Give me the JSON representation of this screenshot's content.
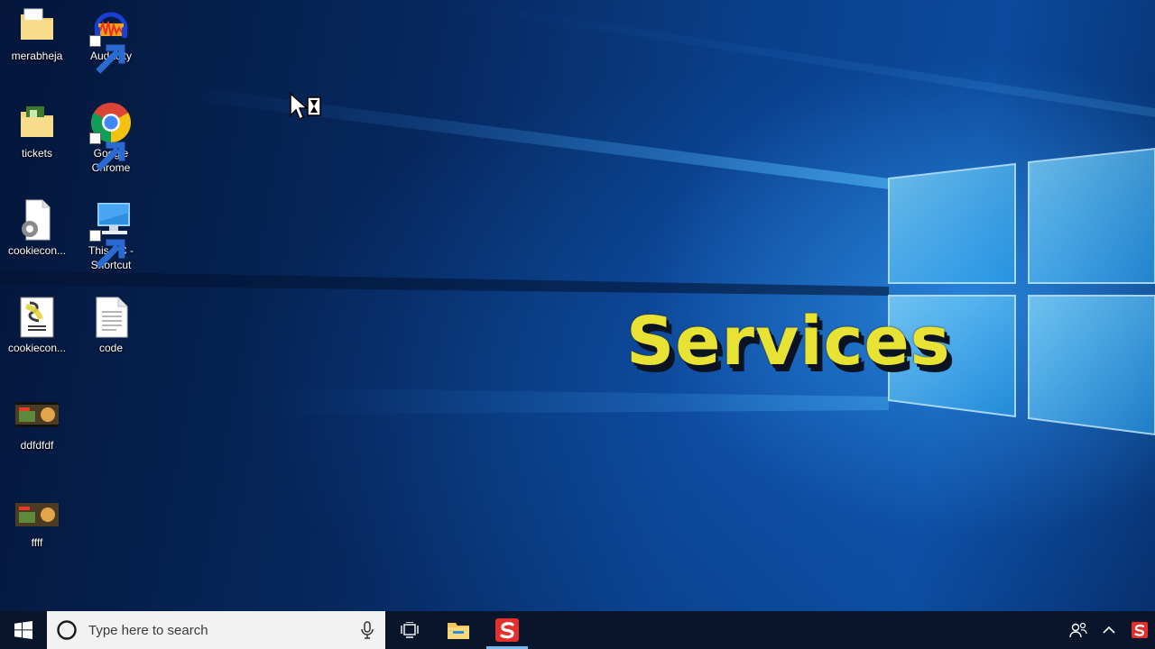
{
  "desktop": {
    "icons": [
      {
        "label": "merabheja",
        "icon": "folder-icon"
      },
      {
        "label": "Audacity",
        "icon": "audacity-icon"
      },
      {
        "label": "tickets",
        "icon": "folder-icon"
      },
      {
        "label": "Google Chrome",
        "icon": "chrome-icon"
      },
      {
        "label": "cookiecon...",
        "icon": "settings-file-icon"
      },
      {
        "label": "This PC - Shortcut",
        "icon": "computer-icon"
      },
      {
        "label": "cookiecon...",
        "icon": "script-file-icon"
      },
      {
        "label": "code",
        "icon": "text-file-icon"
      },
      {
        "label": "ddfdfdf",
        "icon": "image-thumbnail-icon"
      },
      {
        "label": "ffff",
        "icon": "image-thumbnail-icon"
      }
    ]
  },
  "overlay": {
    "title": "Services"
  },
  "taskbar": {
    "search_placeholder": "Type here to search",
    "pinned": [
      "start-icon",
      "task-view-icon",
      "file-explorer-icon",
      "app-s-icon"
    ],
    "tray": [
      "people-icon",
      "chevron-up-icon",
      "app-s-tray-icon"
    ]
  },
  "colors": {
    "taskbar_bg": "#08152a",
    "search_bg": "#f2f2f2",
    "overlay_text": "#e8e235",
    "active_indicator": "#76b9ed",
    "app_s_red": "#e2312d"
  }
}
